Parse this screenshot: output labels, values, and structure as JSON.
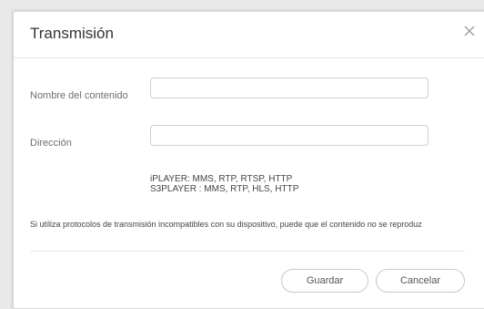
{
  "dialog": {
    "title": "Transmisión",
    "close_icon": "close-icon"
  },
  "form": {
    "content_name_label": "Nombre del contenido",
    "content_name_value": "",
    "address_label": "Dirección",
    "address_value": ""
  },
  "protocols": {
    "iplayer": "iPLAYER: MMS, RTP, RTSP, HTTP",
    "s3player": "S3PLAYER : MMS, RTP, HLS, HTTP"
  },
  "notice": "Si utiliza protocolos de transmisión incompatibles con su dispositivo, puede que el contenido no se reproduz",
  "buttons": {
    "save": "Guardar",
    "cancel": "Cancelar"
  }
}
